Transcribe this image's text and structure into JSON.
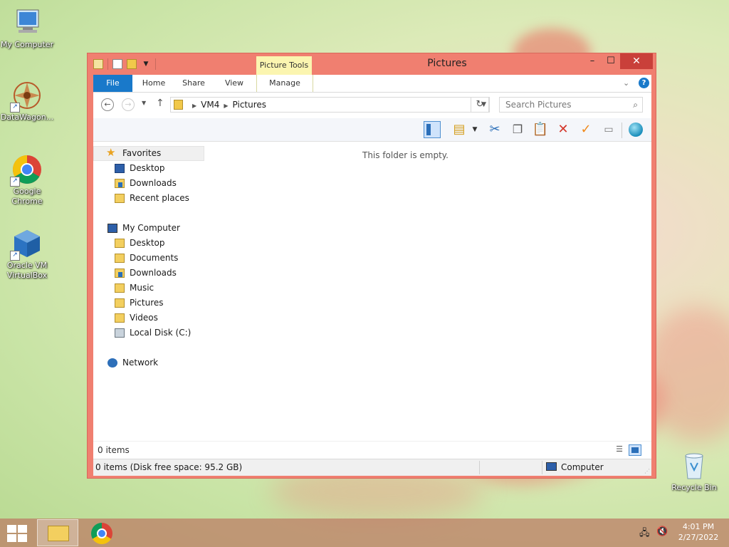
{
  "desktop": {
    "icons": [
      {
        "label": "My Computer"
      },
      {
        "label": "DataWagon..."
      },
      {
        "label": "Google Chrome"
      },
      {
        "label": "Oracle VM VirtualBox"
      },
      {
        "label": "Recycle Bin"
      }
    ]
  },
  "window": {
    "title": "Pictures",
    "context_tab": "Picture Tools",
    "controls": {
      "minimize": "–",
      "maximize": "☐",
      "close": "✕"
    },
    "ribbon_tabs": [
      "File",
      "Home",
      "Share",
      "View",
      "Manage"
    ],
    "address": {
      "crumbs": [
        "VM4",
        "Pictures"
      ]
    },
    "search": {
      "placeholder": "Search Pictures"
    },
    "nav": {
      "favorites": {
        "label": "Favorites",
        "items": [
          "Desktop",
          "Downloads",
          "Recent places"
        ]
      },
      "computer": {
        "label": "My Computer",
        "items": [
          "Desktop",
          "Documents",
          "Downloads",
          "Music",
          "Pictures",
          "Videos",
          "Local Disk (C:)"
        ]
      },
      "network": {
        "label": "Network"
      }
    },
    "empty_message": "This folder is empty.",
    "item_count": "0 items",
    "status": {
      "text": "0 items (Disk free space: 95.2 GB)",
      "location": "Computer"
    }
  },
  "taskbar": {
    "clock_time": "4:01 PM",
    "clock_date": "2/27/2022"
  },
  "colors": {
    "window_frame": "#f07f70",
    "file_tab": "#1979ca",
    "close_button": "#c9403a",
    "context_tab": "#fbf5b0"
  }
}
